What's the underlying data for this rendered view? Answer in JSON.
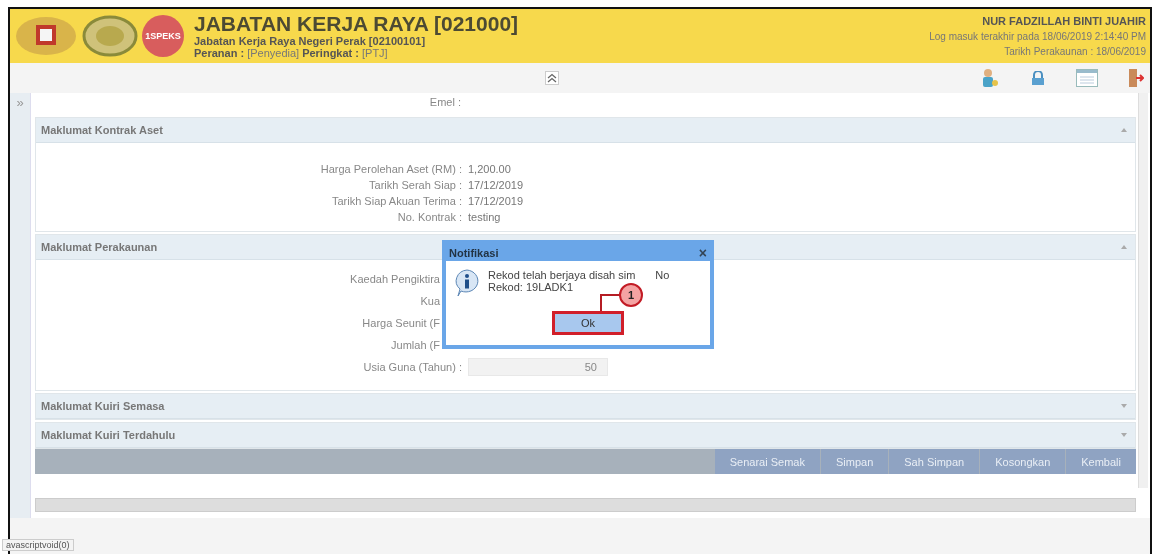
{
  "header": {
    "logo_text": "1SPEKS",
    "title": "JABATAN KERJA RAYA [021000]",
    "subtitle": "Jabatan Kerja Raya Negeri Perak [02100101]",
    "role_label": "Peranan :",
    "role_value": "[Penyedia]",
    "level_label": "Peringkat :",
    "level_value": "[PTJ]",
    "user": "NUR FADZILLAH BINTI JUAHIR",
    "last_login": "Log masuk terakhir pada 18/06/2019 2:14:40 PM",
    "account_date": "Tarikh Perakaunan : 18/06/2019"
  },
  "sidebar_toggle": "»",
  "top_field": {
    "label": "Emel :"
  },
  "sections": [
    {
      "title": "Maklumat Kontrak Aset",
      "expanded": true,
      "rows": [
        {
          "kind": "text",
          "label": "Harga Perolehan Aset (RM) :",
          "value": "1,200.00"
        },
        {
          "kind": "text",
          "label": "Tarikh Serah Siap :",
          "value": "17/12/2019"
        },
        {
          "kind": "text",
          "label": "Tarikh Siap Akuan Terima :",
          "value": "17/12/2019"
        },
        {
          "kind": "text",
          "label": "No. Kontrak :",
          "value": "testing"
        }
      ]
    },
    {
      "title": "Maklumat Perakaunan",
      "expanded": true,
      "rows": [
        {
          "kind": "partial",
          "label": "Kaedah Pengiktira"
        },
        {
          "kind": "partial",
          "label": "Kua"
        },
        {
          "kind": "partial",
          "label": "Harga Seunit (F"
        },
        {
          "kind": "partial",
          "label": "Jumlah (F"
        },
        {
          "kind": "field",
          "label": "Usia Guna (Tahun) :",
          "value": "50"
        }
      ]
    },
    {
      "title": "Maklumat Kuiri Semasa",
      "expanded": false
    },
    {
      "title": "Maklumat Kuiri Terdahulu",
      "expanded": false
    }
  ],
  "buttons": [
    "Senarai Semak",
    "Simpan",
    "Sah Simpan",
    "Kosongkan",
    "Kembali"
  ],
  "dialog": {
    "title": "Notifikasi",
    "close": "×",
    "message_line1": "Rekod telah berjaya disah sim",
    "message_line1_end": "No",
    "message_line2": "Rekod: 19LADK1",
    "ok": "Ok",
    "callout": "1"
  },
  "status_bar": "avascriptvoid(0)"
}
